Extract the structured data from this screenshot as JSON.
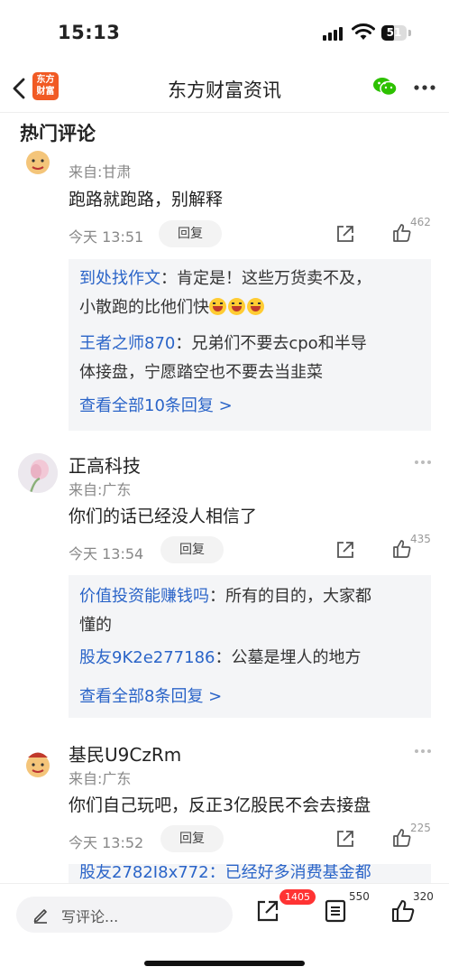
{
  "status_bar": {
    "time": "15:13",
    "battery": "51",
    "battery_level": 0.51
  },
  "nav": {
    "logo_text": "东方财富",
    "title": "东方财富资讯"
  },
  "section_title": "热门评论",
  "comments": [
    {
      "username": "",
      "location": "来自:甘肃",
      "text": "跑路就跑路，别解释",
      "time": "今天 13:51",
      "reply_label": "回复",
      "likes": "462",
      "replies": [
        {
          "name": "到处找作文",
          "sep": "：",
          "text": "肯定是！这些万货卖不及，",
          "text2": "小散跑的比他们快"
        },
        {
          "name": "王者之师870",
          "sep": "：",
          "text": "兄弟们不要去cpo和半导",
          "text2": "体接盘，宁愿踏空也不要去当韭菜"
        }
      ],
      "view_all": "查看全部10条回复 >"
    },
    {
      "username": "正高科技",
      "location": "来自:广东",
      "text": "你们的话已经没人相信了",
      "time": "今天 13:54",
      "reply_label": "回复",
      "likes": "435",
      "replies": [
        {
          "name": "价值投资能赚钱吗",
          "sep": "：",
          "text": "所有的目的，大家都",
          "text2": "懂的"
        },
        {
          "name": "股友9K2e277186",
          "sep": "：",
          "text": "公墓是埋人的地方",
          "text2": ""
        }
      ],
      "view_all": "查看全部8条回复 >"
    },
    {
      "username": "基民U9CzRm",
      "location": "来自:广东",
      "text": "你们自己玩吧，反正3亿股民不会去接盘",
      "time": "今天 13:52",
      "reply_label": "回复",
      "likes": "225",
      "partial_reply": "股友2782I8x772：已经好多消费基金都"
    }
  ],
  "bottom_bar": {
    "placeholder": "写评论...",
    "share_count": "1405",
    "comment_count": "550",
    "like_count": "320"
  },
  "colors": {
    "link_blue": "#2a64c8",
    "brand_orange": "#f15a24",
    "badge_red": "#ff3333",
    "wechat_green": "#2dc100"
  },
  "icons": [
    "back-icon",
    "wechat-icon",
    "more-icon",
    "share-icon",
    "like-icon",
    "pen-icon",
    "comment-list-icon"
  ]
}
